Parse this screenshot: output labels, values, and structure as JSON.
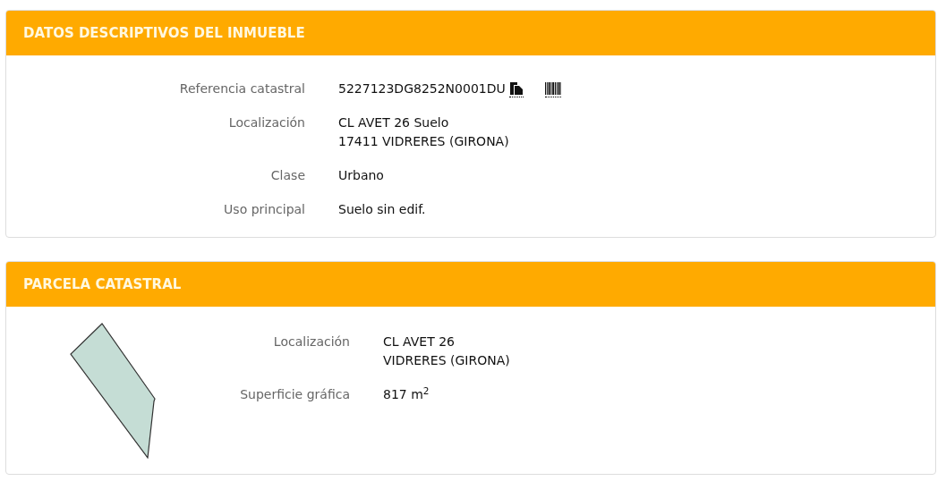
{
  "inmueble": {
    "title": "DATOS DESCRIPTIVOS DEL INMUEBLE",
    "rows": [
      {
        "label": "Referencia catastral",
        "values": [
          "5227123DG8252N0001DU"
        ],
        "kind": "reference"
      },
      {
        "label": "Localización",
        "values": [
          "CL AVET 26 Suelo",
          "17411 VIDRERES (GIRONA)"
        ],
        "kind": "text"
      },
      {
        "label": "Clase",
        "values": [
          "Urbano"
        ],
        "kind": "text"
      },
      {
        "label": "Uso principal",
        "values": [
          "Suelo sin edif."
        ],
        "kind": "text"
      }
    ]
  },
  "parcela": {
    "title": "PARCELA CATASTRAL",
    "rows": [
      {
        "label": "Localización",
        "values": [
          "CL AVET 26",
          "VIDRERES (GIRONA)"
        ]
      },
      {
        "label": "Superficie gráfica",
        "values": [
          "817 m$^{2}$"
        ]
      }
    ]
  }
}
